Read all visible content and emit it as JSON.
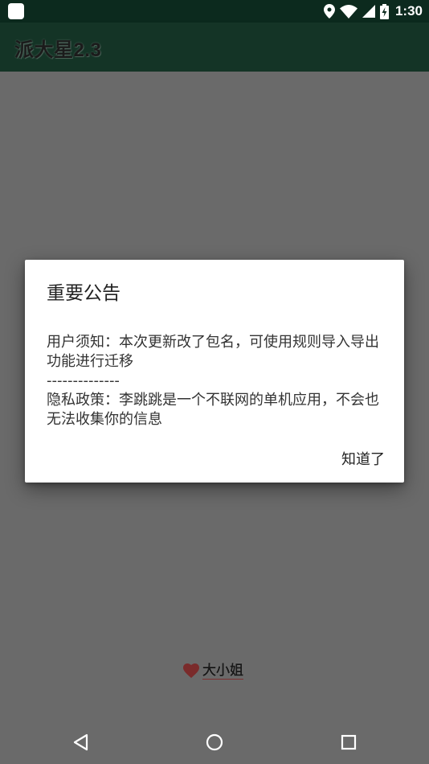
{
  "status_bar": {
    "time": "1:30",
    "icons": [
      "app-notification-icon",
      "location-icon",
      "wifi-icon",
      "signal-icon",
      "battery-charging-icon"
    ]
  },
  "app_bar": {
    "title": "派大星2.3"
  },
  "dialog": {
    "title": "重要公告",
    "message_lines": [
      "用户须知：本次更新改了包名，可使用规则导入导出功能进行迁移",
      "--------------",
      "隐私政策：李跳跳是一个不联网的单机应用，不会也无法收集你的信息"
    ],
    "positive_button": "知道了"
  },
  "brand": {
    "label": "大小姐",
    "icon": "heart-icon",
    "icon_color": "#7a2b2b"
  },
  "nav_bar": {
    "buttons": [
      "back-icon",
      "home-icon",
      "recents-icon"
    ]
  },
  "colors": {
    "status_bar": "#0c2a1e",
    "app_bar": "#143426",
    "scrim": "#6a6a6a",
    "dialog_bg": "#ffffff"
  }
}
